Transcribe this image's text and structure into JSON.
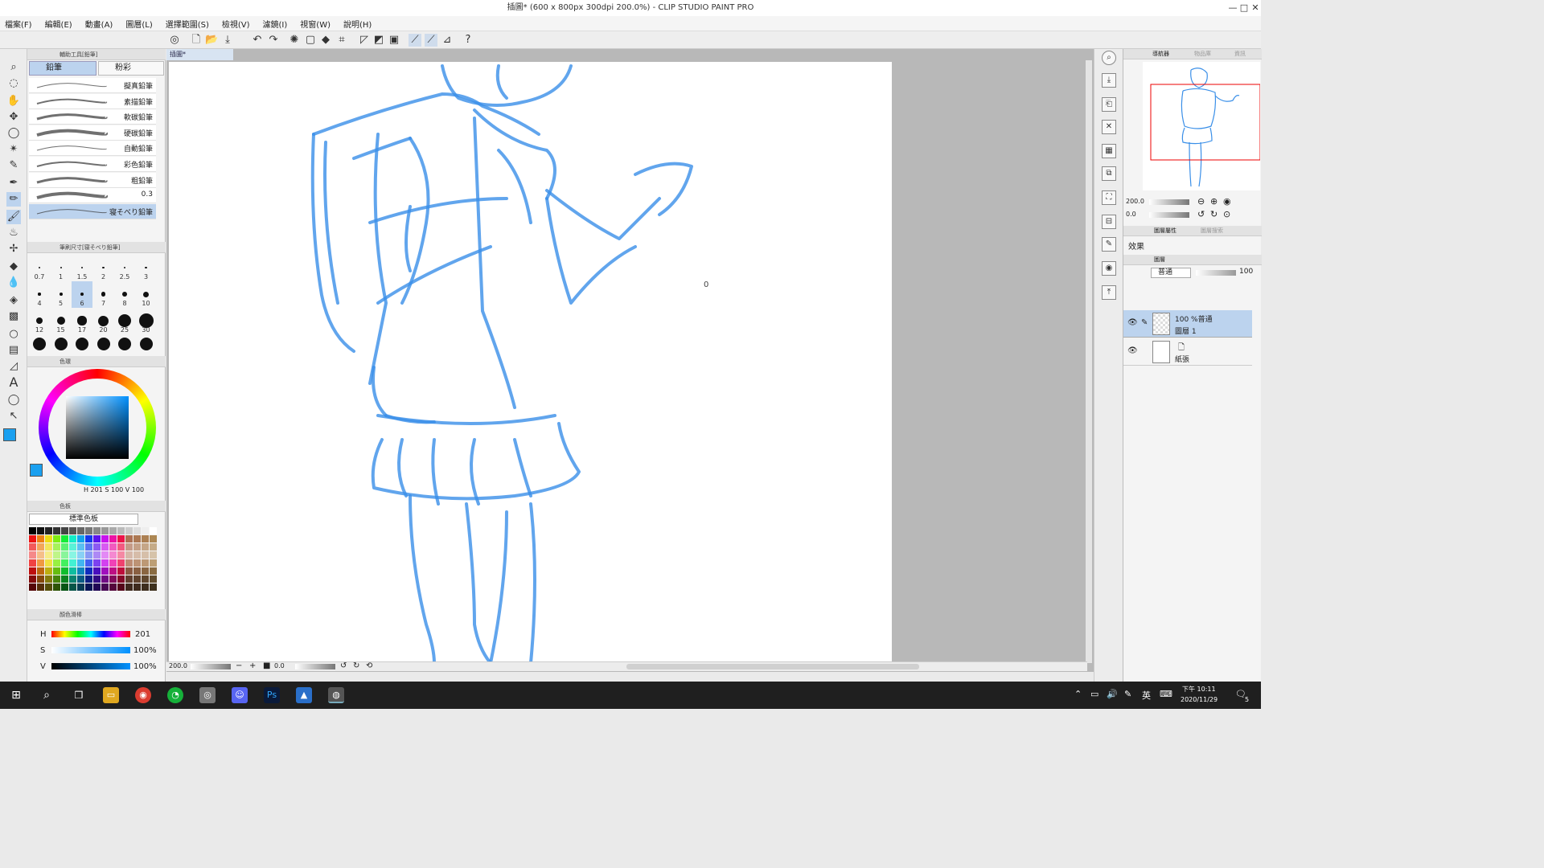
{
  "window": {
    "title": "插圖* (600 x 800px 300dpi 200.0%) - CLIP STUDIO PAINT PRO",
    "minimize": "—",
    "maximize": "□",
    "close": "✕"
  },
  "menu": [
    "檔案(F)",
    "編輯(E)",
    "動畫(A)",
    "圖層(L)",
    "選擇範圍(S)",
    "檢視(V)",
    "濾鏡(I)",
    "視窗(W)",
    "說明(H)"
  ],
  "subtool": {
    "header": "輔助工具[鉛筆]",
    "tab_pencil": "鉛筆",
    "tab_pastel": "粉彩",
    "brushes": [
      "擬真鉛筆",
      "素描鉛筆",
      "軟碳鉛筆",
      "硬碳鉛筆",
      "自動鉛筆",
      "彩色鉛筆",
      "粗鉛筆",
      "0.3",
      "寝そべり鉛筆"
    ]
  },
  "brush_size": {
    "header": "筆刷尺寸[寝そべり鉛筆]",
    "sizes": [
      "0.7",
      "1",
      "1.5",
      "2",
      "2.5",
      "3",
      "4",
      "5",
      "6",
      "7",
      "8",
      "10",
      "12",
      "15",
      "17",
      "20",
      "25",
      "30"
    ]
  },
  "color_wheel": {
    "header": "色環",
    "readout": "H 201 S 100 V 100",
    "main_color": "#1aa0f0",
    "sub_color": "#ffffff"
  },
  "palette": {
    "header": "色板",
    "selected": "標準色板"
  },
  "sliders": {
    "header": "顏色滑棒",
    "h_label": "H",
    "h_value": "201",
    "s_label": "S",
    "s_value": "100%",
    "v_label": "V",
    "v_value": "100%"
  },
  "canvas": {
    "tab": "插圖*",
    "zoom": "200.0",
    "rotation": "0.0",
    "stroke_color": "#3a8fe8"
  },
  "navigator": {
    "tabs": [
      "導航器",
      "物品庫",
      "資訊"
    ],
    "zoom": "200.0",
    "rotation": "0.0"
  },
  "layer_property": {
    "tabs": [
      "圖層屬性",
      "圖層搜索"
    ],
    "effect": "效果"
  },
  "layers": {
    "tab": "圖層",
    "blend": "普通",
    "opacity": "100",
    "items": [
      {
        "mode": "100 %普通",
        "name": "圖層 1"
      },
      {
        "mode": "",
        "name": "紙張"
      }
    ]
  },
  "taskbar": {
    "time_ampm": "下午 10:11",
    "date": "2020/11/29",
    "ime": "英",
    "notify_count": "5"
  }
}
